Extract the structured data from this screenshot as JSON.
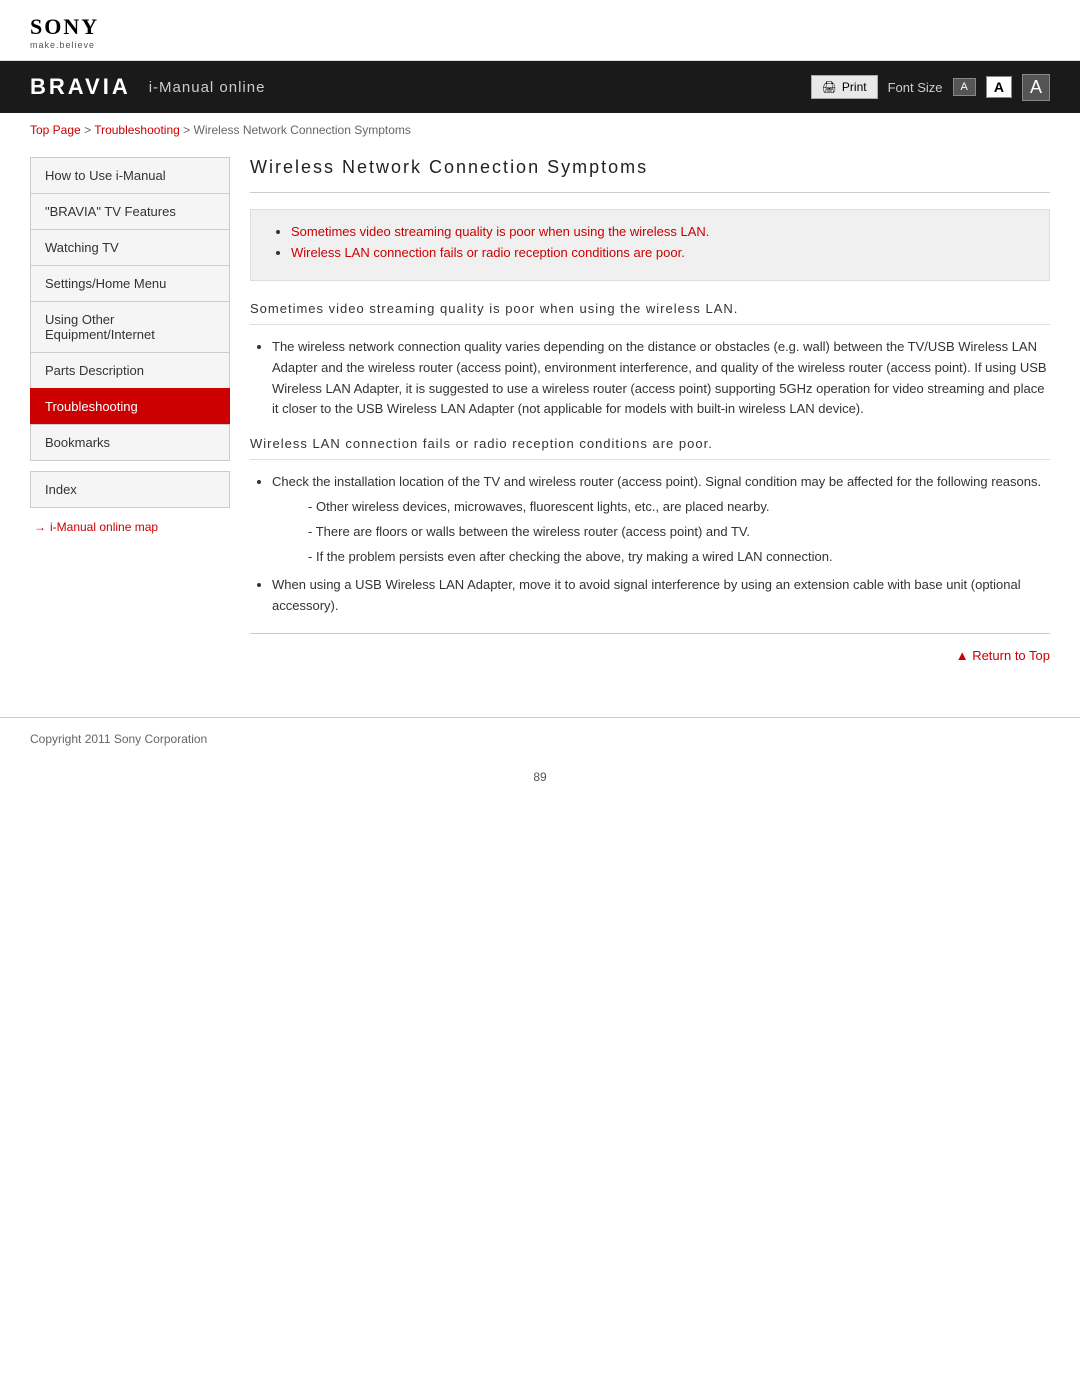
{
  "header": {
    "sony_logo": "SONY",
    "sony_tagline": "make.believe"
  },
  "navbar": {
    "bravia_logo": "BRAVIA",
    "title": "i-Manual online",
    "print_label": "Print",
    "font_size_label": "Font Size",
    "font_btn_small": "A",
    "font_btn_medium": "A",
    "font_btn_large": "A"
  },
  "breadcrumb": {
    "top_page": "Top Page",
    "separator1": " > ",
    "troubleshooting": "Troubleshooting",
    "separator2": " > ",
    "current": "Wireless Network Connection Symptoms"
  },
  "sidebar": {
    "items": [
      {
        "id": "how-to-use",
        "label": "How to Use i-Manual",
        "active": false
      },
      {
        "id": "bravia-features",
        "label": "\"BRAVIA\" TV Features",
        "active": false
      },
      {
        "id": "watching-tv",
        "label": "Watching TV",
        "active": false
      },
      {
        "id": "settings-home",
        "label": "Settings/Home Menu",
        "active": false
      },
      {
        "id": "using-other",
        "label": "Using Other Equipment/Internet",
        "active": false
      },
      {
        "id": "parts-description",
        "label": "Parts Description",
        "active": false
      },
      {
        "id": "troubleshooting",
        "label": "Troubleshooting",
        "active": true
      },
      {
        "id": "bookmarks",
        "label": "Bookmarks",
        "active": false
      }
    ],
    "index_label": "Index",
    "map_link": "i-Manual online map",
    "map_arrow": "→"
  },
  "content": {
    "page_title": "Wireless Network Connection Symptoms",
    "summary_links": [
      "Sometimes video streaming quality is poor when using the wireless LAN.",
      "Wireless LAN connection fails or radio reception conditions are poor."
    ],
    "section1": {
      "title": "Sometimes video streaming quality is poor when using the wireless LAN.",
      "bullets": [
        "The wireless network connection quality varies depending on the distance or obstacles (e.g. wall) between the TV/USB Wireless LAN Adapter and the wireless router (access point), environment interference, and quality of the wireless router (access point). If using USB Wireless LAN Adapter, it is suggested to use a wireless router (access point) supporting 5GHz operation for video streaming and place it closer to the USB Wireless LAN Adapter (not applicable for models with built-in wireless LAN device)."
      ]
    },
    "section2": {
      "title": "Wireless LAN connection fails or radio reception conditions are poor.",
      "bullets": [
        {
          "text": "Check the installation location of the TV and wireless router (access point). Signal condition may be affected for the following reasons.",
          "subitems": [
            "Other wireless devices, microwaves, fluorescent lights, etc., are placed nearby.",
            "There are floors or walls between the wireless router (access point) and TV.",
            "If the problem persists even after checking the above, try making a wired LAN connection."
          ]
        },
        {
          "text": "When using a USB Wireless LAN Adapter, move it to avoid signal interference by using an extension cable with base unit (optional accessory).",
          "subitems": []
        }
      ]
    },
    "return_to_top": "Return to Top"
  },
  "footer": {
    "copyright": "Copyright 2011 Sony Corporation"
  },
  "page_number": "89"
}
